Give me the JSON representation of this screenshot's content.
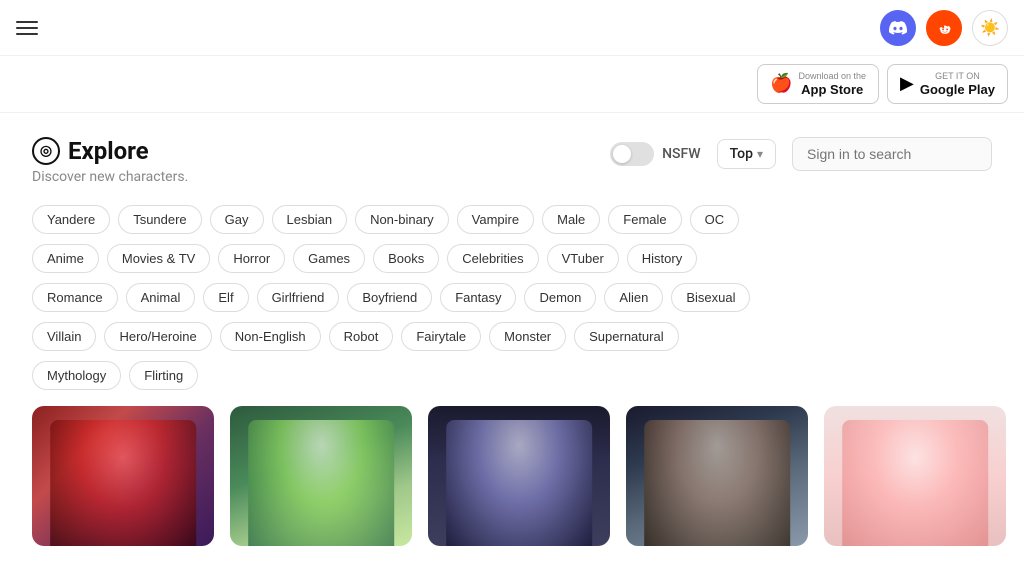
{
  "topbar": {
    "menu_label": "menu",
    "discord_icon": "discord",
    "reddit_icon": "reddit",
    "theme_icon": "☀"
  },
  "store_bar": {
    "app_store": {
      "pre": "Download on the",
      "name": "App Store"
    },
    "google_play": {
      "pre": "GET IT ON",
      "name": "Google Play"
    }
  },
  "page": {
    "title": "Explore",
    "subtitle": "Discover new characters.",
    "nsfw_label": "NSFW",
    "sort_label": "Top",
    "search_placeholder": "Sign in to search"
  },
  "tags": {
    "row1": [
      "Yandere",
      "Tsundere",
      "Gay",
      "Lesbian",
      "Non-binary",
      "Vampire",
      "Male",
      "Female",
      "OC"
    ],
    "row2": [
      "Anime",
      "Movies & TV",
      "Horror",
      "Games",
      "Books",
      "Celebrities",
      "VTuber",
      "History"
    ],
    "row3": [
      "Romance",
      "Animal",
      "Elf",
      "Girlfriend",
      "Boyfriend",
      "Fantasy",
      "Demon",
      "Alien",
      "Bisexual"
    ],
    "row4": [
      "Villain",
      "Hero/Heroine",
      "Non-English",
      "Robot",
      "Fairytale",
      "Monster",
      "Supernatural"
    ],
    "row5": [
      "Mythology",
      "Flirting"
    ]
  },
  "cards": [
    {
      "id": 1,
      "theme": "dark-red"
    },
    {
      "id": 2,
      "theme": "green"
    },
    {
      "id": 3,
      "theme": "dark-blue"
    },
    {
      "id": 4,
      "theme": "brown"
    },
    {
      "id": 5,
      "theme": "pink"
    }
  ]
}
